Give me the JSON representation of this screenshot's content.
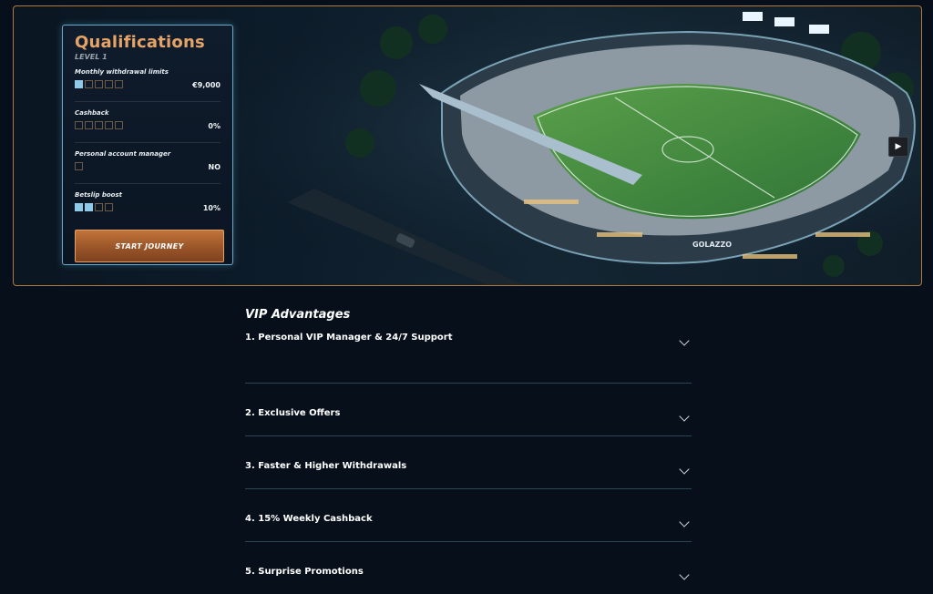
{
  "hero": {
    "stadium_sign": "GOLAZZO",
    "next_icon": "play-arrow"
  },
  "qualifications": {
    "title": "Qualifications",
    "level": "LEVEL 1",
    "rows": [
      {
        "label": "Monthly withdrawal limits",
        "value": "€9,000",
        "filled": 1,
        "total": 5
      },
      {
        "label": "Cashback",
        "value": "0%",
        "filled": 0,
        "total": 5
      },
      {
        "label": "Personal account manager",
        "value": "NO",
        "filled": 0,
        "total": 1
      },
      {
        "label": "Betslip boost",
        "value": "10%",
        "filled": 2,
        "total": 4
      }
    ],
    "button": "START JOURNEY"
  },
  "vip": {
    "title": "VIP Advantages",
    "items": [
      "1. Personal VIP Manager & 24/7 Support",
      "2. Exclusive Offers",
      "3. Faster & Higher Withdrawals",
      "4. 15% Weekly Cashback",
      "5. Surprise Promotions"
    ]
  },
  "colors": {
    "accent": "#e6a367",
    "button": "#9a5528",
    "card_border": "#6aa9c8",
    "background": "#07101a"
  }
}
